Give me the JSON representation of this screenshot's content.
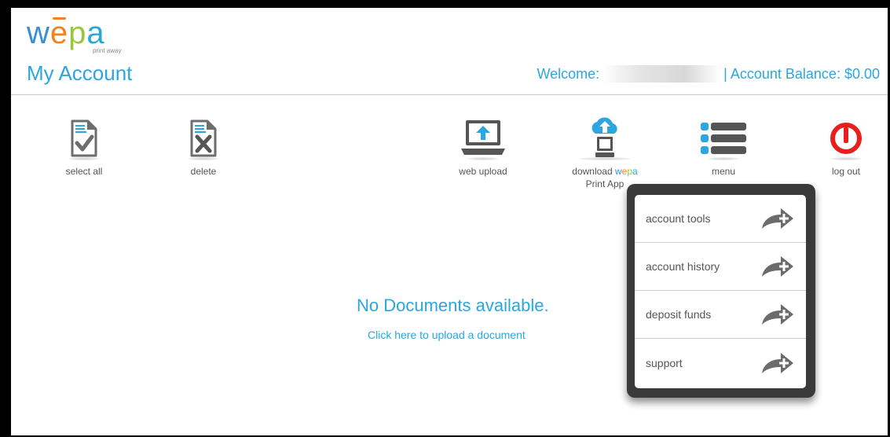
{
  "brand": {
    "logo_letters": [
      "w",
      "e",
      "p",
      "a"
    ],
    "logo_tagline": "print away",
    "colors": {
      "w": "#3a8fd0",
      "e": "#f2821e",
      "p": "#9bc53d",
      "a": "#29a8d6"
    }
  },
  "header": {
    "title": "My Account",
    "welcome_label": "Welcome:",
    "balance_text": "| Account Balance: $0.00",
    "accent": "#2ba6de"
  },
  "toolbar": {
    "select_all": {
      "label": "select all",
      "icon": "document-check-icon"
    },
    "delete": {
      "label": "delete",
      "icon": "document-x-icon"
    },
    "web_upload": {
      "label": "web upload",
      "icon": "laptop-upload-icon"
    },
    "download": {
      "label_prefix": "download",
      "label_brand_w": "w",
      "label_brand_e": "e",
      "label_brand_p": "p",
      "label_brand_a": "a",
      "label_suffix": "Print App",
      "icon": "cloud-download-computer-icon"
    },
    "menu": {
      "label": "menu",
      "icon": "list-menu-icon"
    },
    "logout": {
      "label": "log out",
      "icon": "power-icon",
      "color": "#e8201c"
    }
  },
  "main": {
    "empty_title": "No Documents available.",
    "upload_link": "Click here to upload a document"
  },
  "dropdown": {
    "items": [
      {
        "label": "account tools",
        "icon": "arrow-plus-icon"
      },
      {
        "label": "account history",
        "icon": "arrow-plus-icon"
      },
      {
        "label": "deposit funds",
        "icon": "arrow-plus-icon"
      },
      {
        "label": "support",
        "icon": "arrow-plus-icon"
      }
    ]
  }
}
